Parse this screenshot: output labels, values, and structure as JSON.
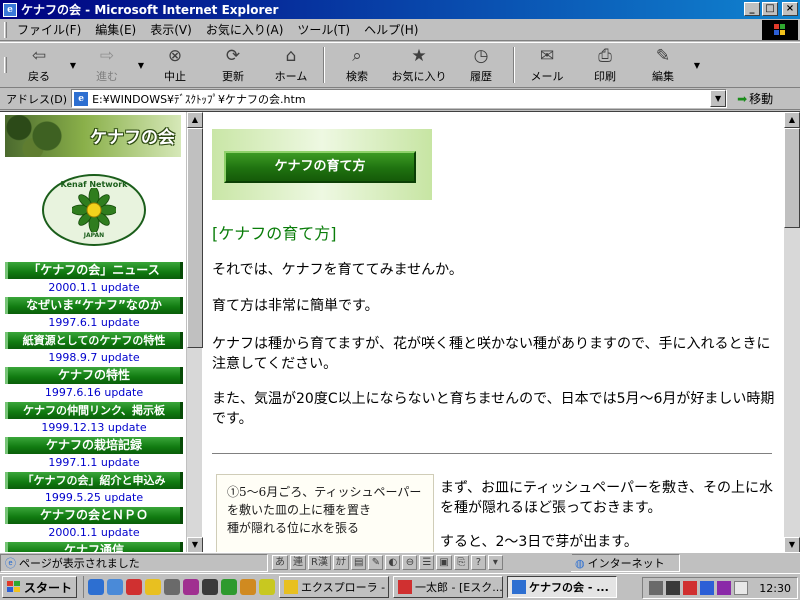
{
  "window": {
    "title": "ケナフの会 - Microsoft Internet Explorer",
    "controls": {
      "minimize": "_",
      "maximize": "□",
      "close": "×"
    }
  },
  "menu": [
    "ファイル(F)",
    "編集(E)",
    "表示(V)",
    "お気に入り(A)",
    "ツール(T)",
    "ヘルプ(H)"
  ],
  "toolbar": {
    "back": "戻る",
    "forward": "進む",
    "stop": "中止",
    "refresh": "更新",
    "home": "ホーム",
    "search": "検索",
    "favorites": "お気に入り",
    "history": "履歴",
    "mail": "メール",
    "print": "印刷",
    "edit": "編集"
  },
  "address": {
    "label": "アドレス(D)",
    "value": "E:¥WINDOWS¥ﾃﾞｽｸﾄｯﾌﾟ¥ケナフの会.htm",
    "go": "移動"
  },
  "sidebar": {
    "banner_title": "ケナフの会",
    "logo_top": "Kenaf Network",
    "logo_bottom": "JAPAN",
    "nav": [
      {
        "label": "「ケナフの会」ニュース",
        "date": "2000.1.1 update"
      },
      {
        "label": "なぜいま“ケナフ”なのか",
        "date": "1997.6.1 update"
      },
      {
        "label": "紙資源としてのケナフの特性",
        "date": "1998.9.7 update"
      },
      {
        "label": "ケナフの特性",
        "date": "1997.6.16 update"
      },
      {
        "label": "ケナフの仲間リンク、掲示板",
        "date": "1999.12.13 update"
      },
      {
        "label": "ケナフの栽培記録",
        "date": "1997.1.1 update"
      },
      {
        "label": "「ケナフの会」紹介と申込み",
        "date": "1999.5.25 update"
      },
      {
        "label": "ケナフの会とＮＰＯ",
        "date": "2000.1.1 update"
      },
      {
        "label": "ケナフ通信",
        "date": ""
      }
    ]
  },
  "main": {
    "header_button": "ケナフの育て方",
    "heading": "[ケナフの育て方]",
    "paragraphs": [
      "それでは、ケナフを育ててみませんか。",
      "育て方は非常に簡単です。",
      "ケナフは種から育てますが、花が咲く種と咲かない種がありますので、手に入れるときに注意してください。",
      "また、気温が20度C以上にならないと育ちませんので、日本では5月～6月が好ましい時期です。"
    ],
    "sketch_lines": [
      "①5～6月ごろ、ティッシュペーパー",
      "を敷いた皿の上に種を置き",
      "種が隠れる位に水を張る"
    ],
    "step_text": [
      "まず、お皿にティッシュペーパーを敷き、その上に水を種が隠れるほど張っておきます。",
      "すると、2～3日で芽が出ます。"
    ]
  },
  "statusbar": {
    "message": "ページが表示されました",
    "ime": [
      "あ",
      "連",
      "R漢",
      "ｶﾅ"
    ],
    "zone": "インターネット"
  },
  "taskbar": {
    "start": "スタート",
    "tasks": [
      {
        "label": "エクスプローラ - ...",
        "active": false
      },
      {
        "label": "一太郎 - [Eスク...",
        "active": false
      },
      {
        "label": "ケナフの会 - ...",
        "active": true
      }
    ],
    "clock": "12:30"
  },
  "colors": {
    "titlebar": "#000080",
    "nav_green": "#107a10",
    "heading_green": "#0a7d0a",
    "link_blue": "#0000cc"
  }
}
